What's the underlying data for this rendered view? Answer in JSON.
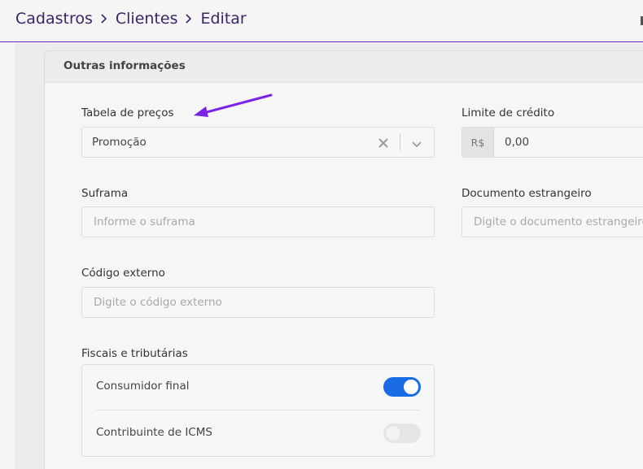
{
  "breadcrumb": [
    "Cadastros",
    "Clientes",
    "Editar"
  ],
  "card": {
    "title": "Outras informações"
  },
  "fields": {
    "tabela_precos": {
      "label": "Tabela de preços",
      "value": "Promoção"
    },
    "limite_credito": {
      "label": "Limite de crédito",
      "prefix": "R$",
      "value": "0,00"
    },
    "suframa": {
      "label": "Suframa",
      "placeholder": "Informe o suframa"
    },
    "documento_estrangeiro": {
      "label": "Documento estrangeiro",
      "placeholder": "Digite o documento estrangeiro"
    },
    "codigo_externo": {
      "label": "Código externo",
      "placeholder": "Digite o código externo"
    }
  },
  "fiscal": {
    "label": "Fiscais e tributárias",
    "items": [
      {
        "label": "Consumidor final",
        "enabled": true
      },
      {
        "label": "Contribuinte de ICMS",
        "enabled": false
      }
    ]
  },
  "colors": {
    "accent": "#6a1fc2",
    "toggle_on": "#1a6ce6",
    "breadcrumb_text": "#3c2468",
    "annotation_arrow": "#7b22e8"
  },
  "icons": {
    "breadcrumb_separator": "chevron-right-icon",
    "select_clear": "close-icon",
    "select_dropdown": "chevron-down-icon",
    "annotation": "arrow-icon"
  }
}
